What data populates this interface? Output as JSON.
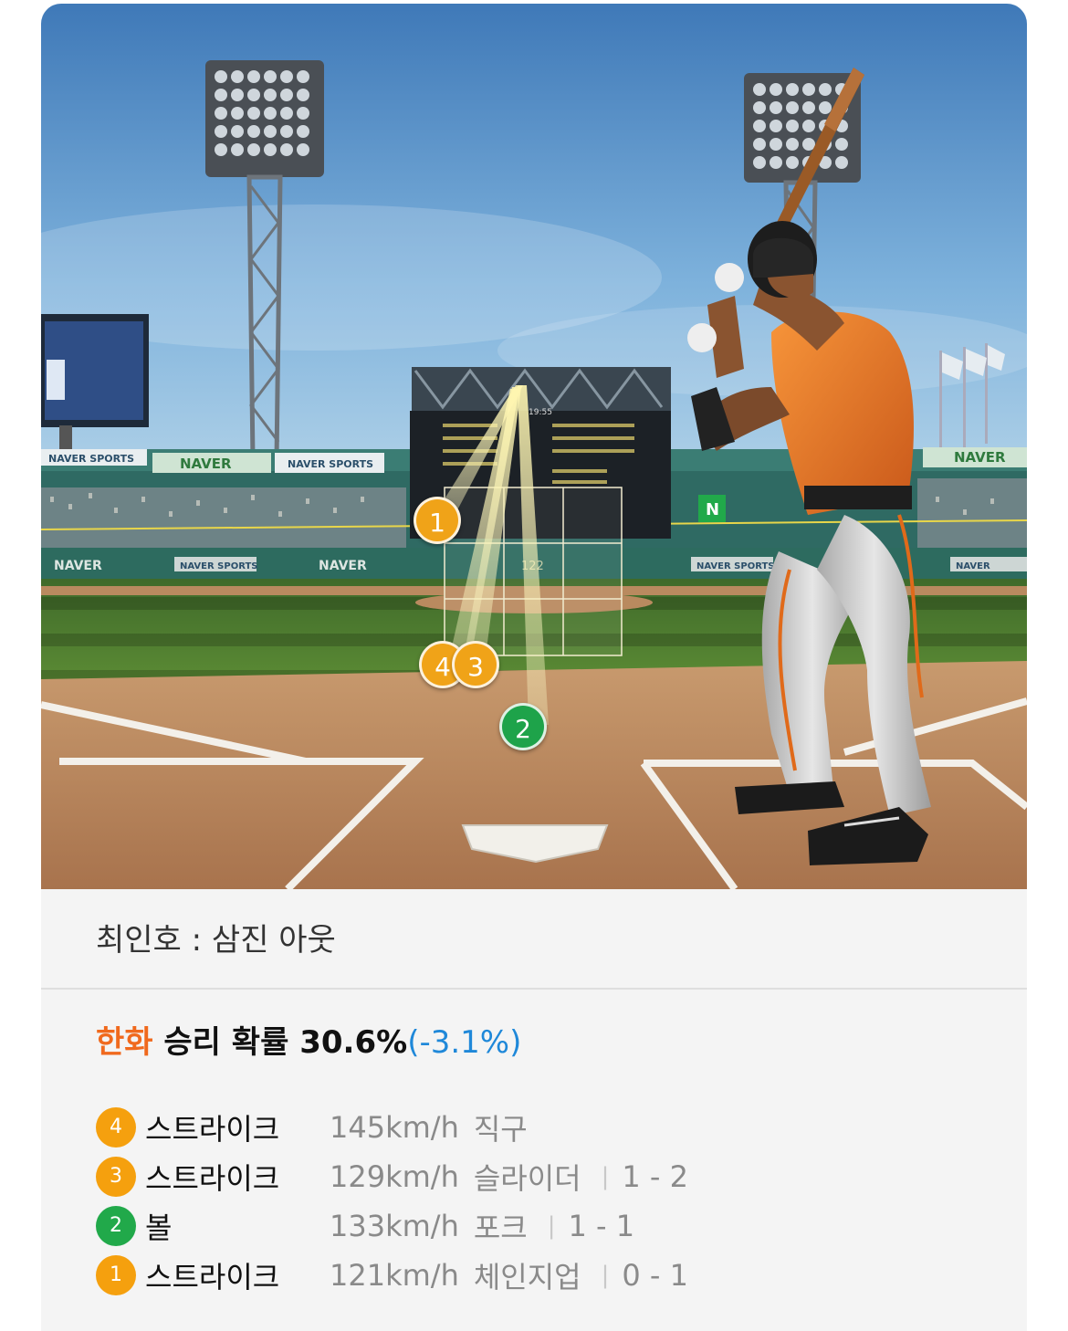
{
  "scene": {
    "ad_labels": [
      "NAVER",
      "NAVER SPORTS",
      "NAVER",
      "NAVER SPORTS",
      "NAVER",
      "NAVER SPORTS",
      "NAVER",
      "NAVER SPORTS",
      "NAVER",
      "N"
    ],
    "speed_readout": "122",
    "scoreboard_clock": "19:55",
    "markers": [
      {
        "num": "1",
        "color": "orange"
      },
      {
        "num": "4",
        "color": "orange"
      },
      {
        "num": "3",
        "color": "orange"
      },
      {
        "num": "2",
        "color": "green"
      }
    ]
  },
  "result": {
    "text": "최인호 : 삼진 아웃"
  },
  "win_probability": {
    "team": "한화",
    "label": "승리 확률",
    "value": "30.6%",
    "delta": "(-3.1%)"
  },
  "colors": {
    "team_accent": "#f0691d",
    "delta_blue": "#1f88d9",
    "strike_orange": "#f5a00e",
    "ball_green": "#21a94a"
  },
  "pitches": [
    {
      "num": "4",
      "result": "스트라이크",
      "speed": "145km/h",
      "type": "직구",
      "count": "",
      "color": "orange"
    },
    {
      "num": "3",
      "result": "스트라이크",
      "speed": "129km/h",
      "type": "슬라이더",
      "count": "1 - 2",
      "color": "orange"
    },
    {
      "num": "2",
      "result": "볼",
      "speed": "133km/h",
      "type": "포크",
      "count": "1 - 1",
      "color": "green"
    },
    {
      "num": "1",
      "result": "스트라이크",
      "speed": "121km/h",
      "type": "체인지업",
      "count": "0 - 1",
      "color": "orange"
    }
  ]
}
